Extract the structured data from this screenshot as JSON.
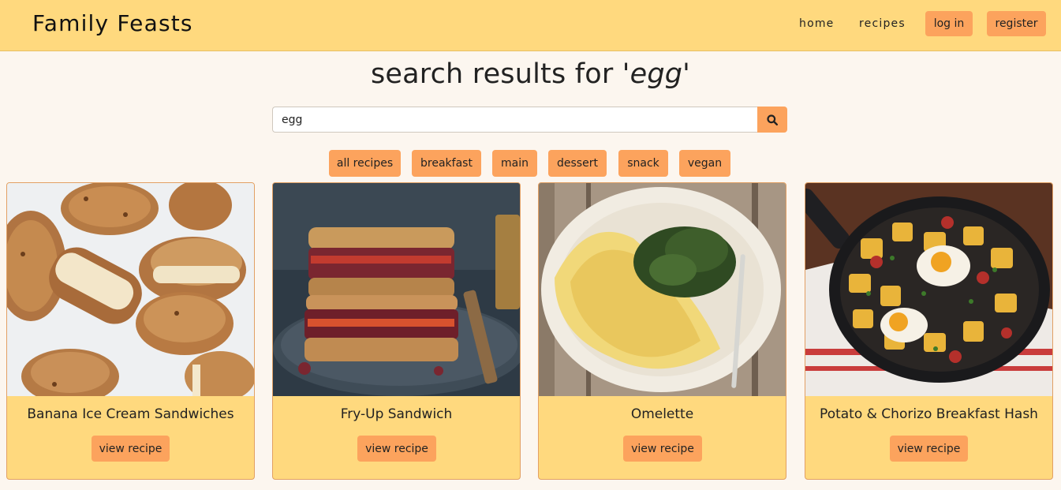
{
  "header": {
    "brand": "Family Feasts",
    "nav": {
      "home": "home",
      "recipes": "recipes",
      "login": "log in",
      "register": "register"
    }
  },
  "page": {
    "title_prefix": "search results for ",
    "title_query": "'egg'"
  },
  "search": {
    "value": "egg",
    "button_icon": "search-icon"
  },
  "filters": [
    "all recipes",
    "breakfast",
    "main",
    "dessert",
    "snack",
    "vegan"
  ],
  "cards": [
    {
      "title": "Banana Ice Cream Sandwiches",
      "button": "view recipe"
    },
    {
      "title": "Fry-Up Sandwich",
      "button": "view recipe"
    },
    {
      "title": "Omelette",
      "button": "view recipe"
    },
    {
      "title": "Potato & Chorizo Breakfast Hash",
      "button": "view recipe"
    }
  ],
  "colors": {
    "header_bg": "#ffd97e",
    "accent": "#fca35d",
    "page_bg": "#fcf6ef",
    "card_bg": "#ffd97e"
  }
}
